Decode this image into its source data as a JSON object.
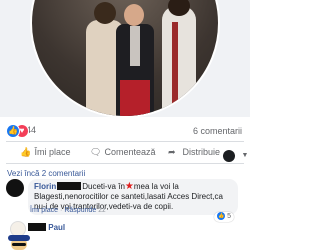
{
  "post": {
    "reactions": {
      "count": "44",
      "types": [
        "like",
        "love"
      ]
    },
    "comments_count_label": "6 comentarii",
    "actions": {
      "like_label": "Îmi place",
      "comment_label": "Comentează",
      "share_label": "Distribuie"
    }
  },
  "comments": {
    "view_more_label": "Vezi încă 2 comentarii",
    "items": [
      {
        "author": "Florin",
        "text_a": "Duceti-va în",
        "text_b": "mea la voi la Blagesti,nenorocitilor ce santeti,lasati Acces Direct,ca nu-i de voi trantorilor,vedeti-va de copii.",
        "reaction_count": "5",
        "like_label": "Îmi place",
        "reply_label": "Răspunde",
        "time": "2z"
      },
      {
        "author": "Paul"
      }
    ]
  },
  "colors": {
    "link": "#385898",
    "like_blue": "#1877f2",
    "love_red": "#f33e58",
    "secondary_text": "#65676b",
    "bubble_bg": "#f2f3f5"
  },
  "icons": [
    "like-reaction-icon",
    "love-reaction-icon",
    "thumbs-up-icon",
    "comment-icon",
    "share-arrow-icon",
    "chevron-down-icon"
  ]
}
